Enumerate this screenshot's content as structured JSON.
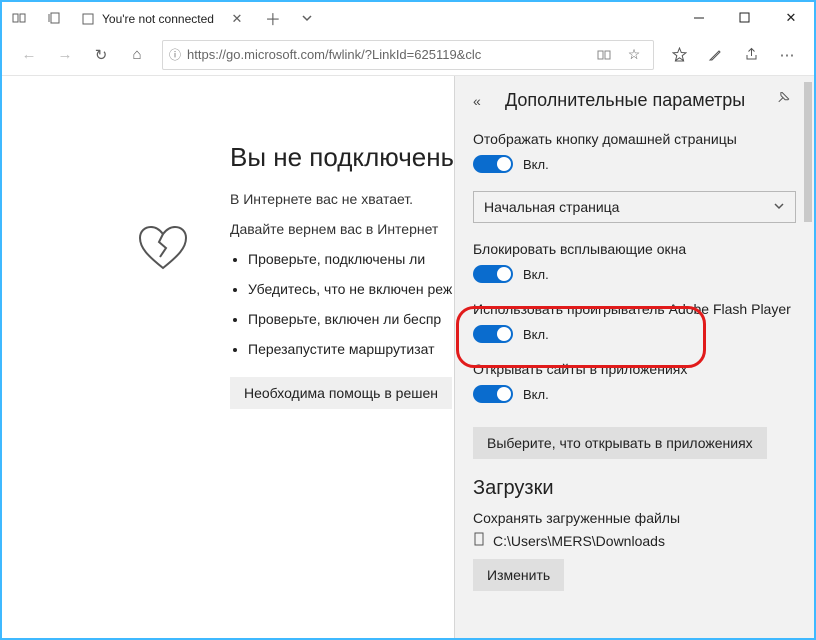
{
  "window": {
    "tab_title": "You're not connected"
  },
  "toolbar": {
    "url_scheme": "https",
    "url_rest": "://go.microsoft.com/fwlink/?LinkId=625119&clc"
  },
  "page": {
    "heading": "Вы не подключены",
    "line1": "В Интернете вас не хватает.",
    "line2": "Давайте вернем вас в Интернет",
    "bullets": [
      "Проверьте, подключены ли",
      "Убедитесь, что не включен реж",
      "Проверьте, включен ли беспр",
      "Перезапустите маршрутизат"
    ],
    "help_button": "Необходима помощь в решен"
  },
  "panel": {
    "title": "Дополнительные параметры",
    "settings": {
      "home_button": {
        "label": "Отображать кнопку домашней страницы",
        "state": "Вкл."
      },
      "home_dropdown": "Начальная страница",
      "popup_block": {
        "label": "Блокировать всплывающие окна",
        "state": "Вкл."
      },
      "flash": {
        "label": "Использовать проигрыватель Adobe Flash Player",
        "state": "Вкл."
      },
      "open_apps": {
        "label": "Открывать сайты в приложениях",
        "state": "Вкл."
      },
      "open_apps_button": "Выберите, что открывать в приложениях"
    },
    "downloads": {
      "heading": "Загрузки",
      "label": "Сохранять загруженные файлы",
      "path": "C:\\Users\\MERS\\Downloads",
      "change": "Изменить"
    }
  }
}
